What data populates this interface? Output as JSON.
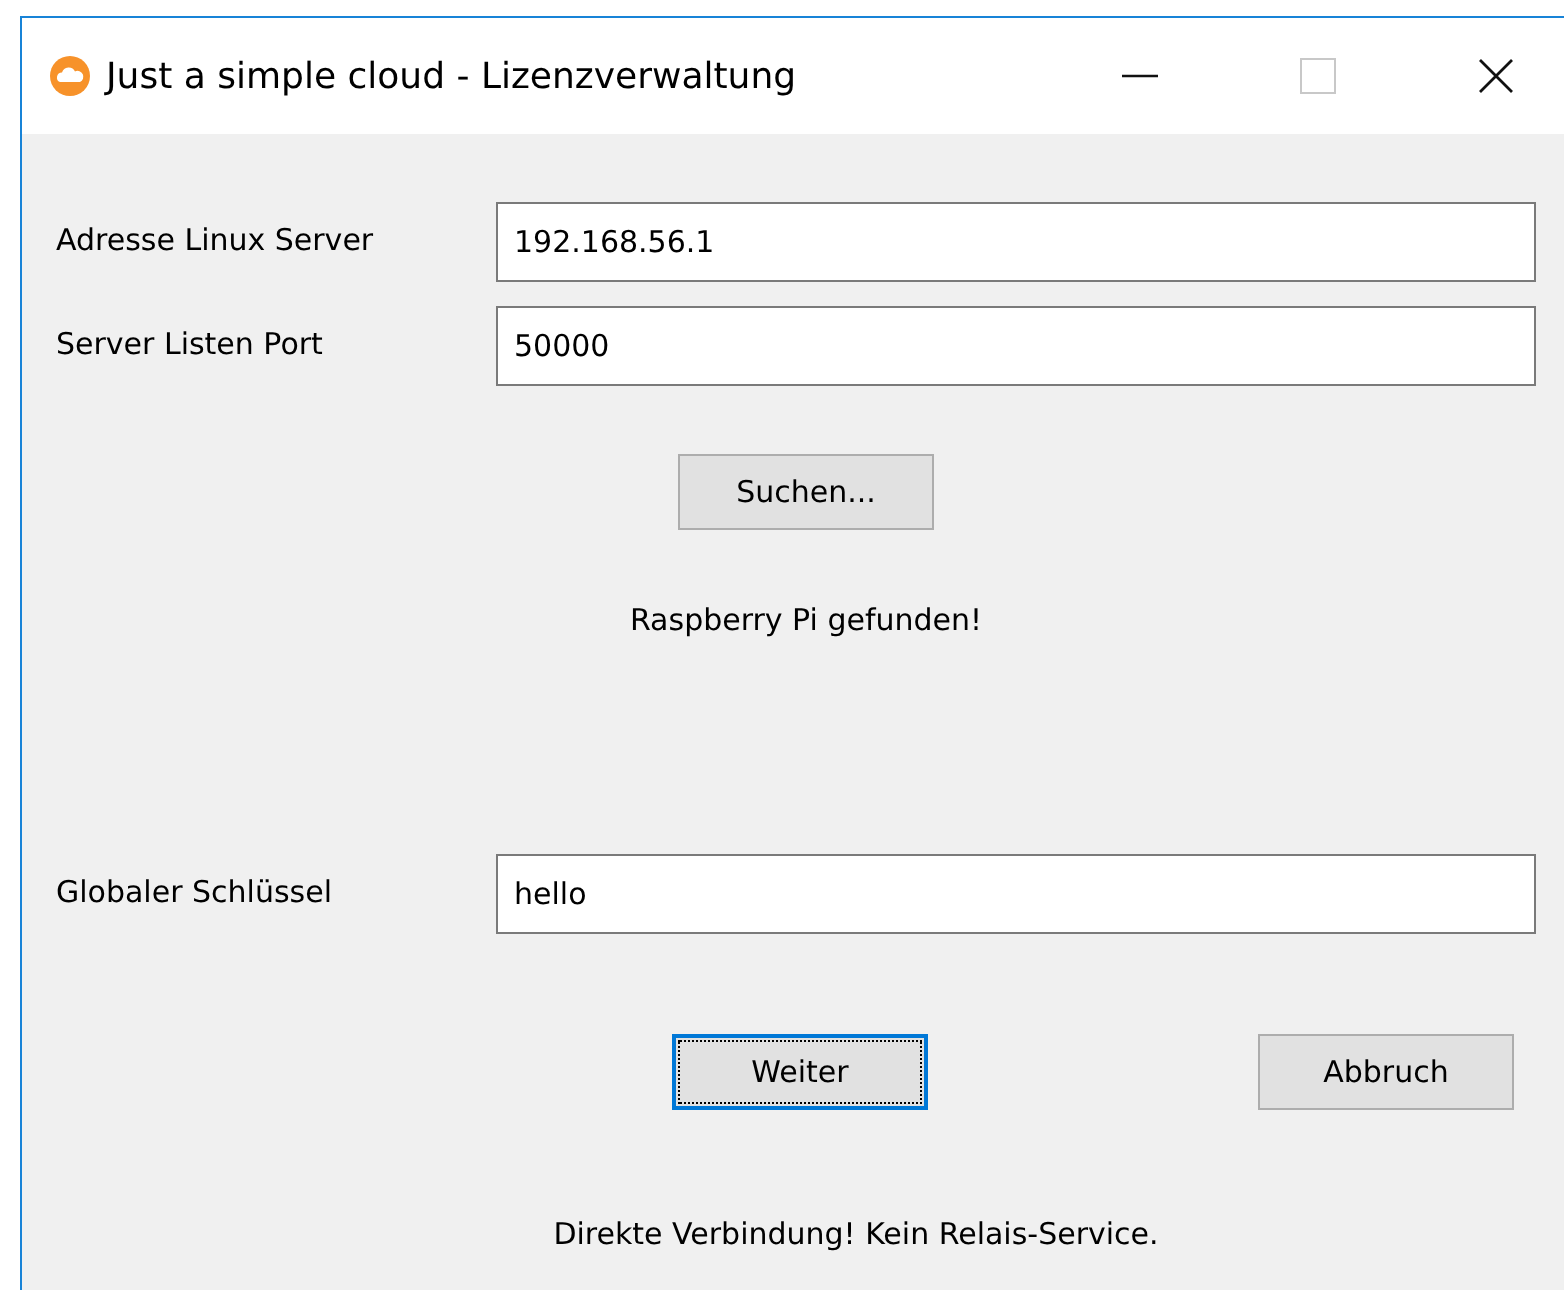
{
  "window": {
    "title": "Just a simple cloud - Lizenzverwaltung"
  },
  "fields": [
    {
      "label": "Adresse Linux Server",
      "value": "192.168.56.1"
    },
    {
      "label": "Server Listen Port",
      "value": "50000"
    }
  ],
  "search_button": {
    "label": "Suchen...",
    "focused": false
  },
  "search_status": "Raspberry Pi gefunden!",
  "key_field": {
    "label": "Globaler Schlüssel",
    "value": "hello"
  },
  "buttons": [
    {
      "label": "Weiter",
      "focused": true
    },
    {
      "label": "Abbruch",
      "focused": false
    }
  ],
  "status_bar": "Direkte Verbindung! Kein Relais-Service."
}
